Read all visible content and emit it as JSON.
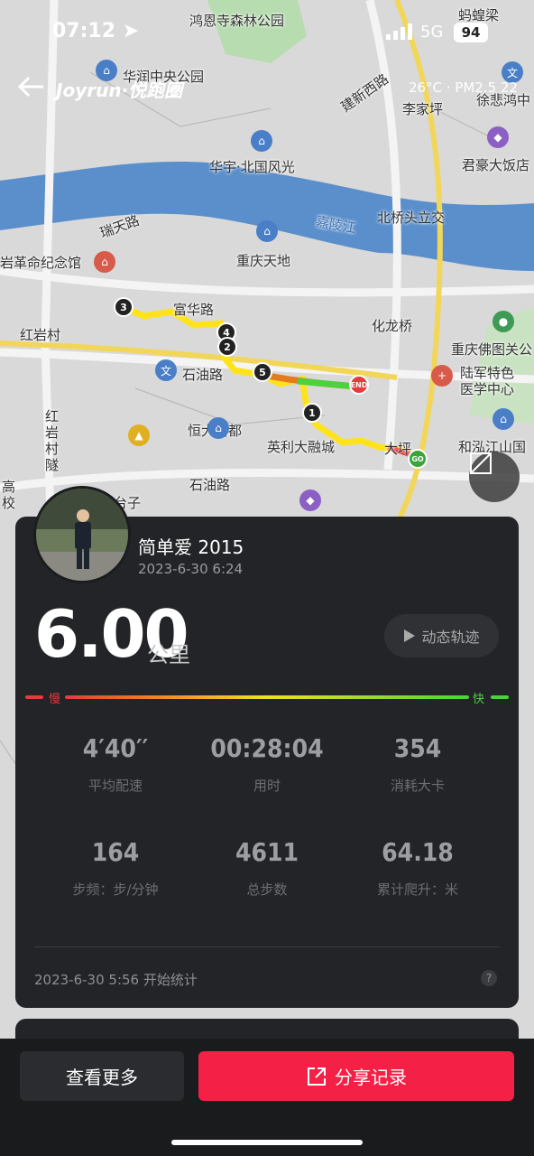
{
  "status_bar": {
    "time": "07:12",
    "network": "5G",
    "battery": "94"
  },
  "header": {
    "brand": "Joyrun·悦跑圈",
    "weather": "26°C · PM2.5 22"
  },
  "map": {
    "labels": [
      "鸿恩寺森林公园",
      "华润中央公园",
      "建新西路",
      "李家坪",
      "徐悲鸿中",
      "君豪大饭店",
      "华宇·北国风光",
      "北桥头立交",
      "嘉陵江",
      "瑞天路",
      "岩革命纪念馆",
      "重庆天地",
      "富华路",
      "化龙桥",
      "红岩村",
      "重庆佛图关公",
      "陆军特色",
      "医学中心",
      "石油路",
      "恒大名都",
      "英利大融城",
      "大坪",
      "和泓江山国",
      "红岩村隧",
      "高校",
      "石油路",
      "台子",
      "蚂蝗梁"
    ],
    "markers": [
      "1",
      "2",
      "3",
      "4",
      "5"
    ],
    "end_label": "END",
    "go_label": "GO"
  },
  "run": {
    "username": "简单爱 2015",
    "datetime": "2023-6-30 6:24",
    "distance": "6.00",
    "distance_unit": "公里",
    "replay_label": "动态轨迹",
    "slow_label": "慢",
    "fast_label": "快",
    "stats": [
      {
        "value": "4′40′′",
        "label": "平均配速"
      },
      {
        "value": "00:28:04",
        "label": "用时"
      },
      {
        "value": "354",
        "label": "消耗大卡"
      },
      {
        "value": "164",
        "label": "步频：步/分钟"
      },
      {
        "value": "4611",
        "label": "总步数"
      },
      {
        "value": "64.18",
        "label": "累计爬升：米"
      }
    ],
    "start_text": "2023-6-30 5:56 开始统计",
    "help": "?"
  },
  "actions": {
    "more_label": "查看更多",
    "share_label": "分享记录"
  },
  "colors": {
    "accent": "#f52046",
    "slow": "#e53b3b",
    "fast": "#4bd23c"
  }
}
